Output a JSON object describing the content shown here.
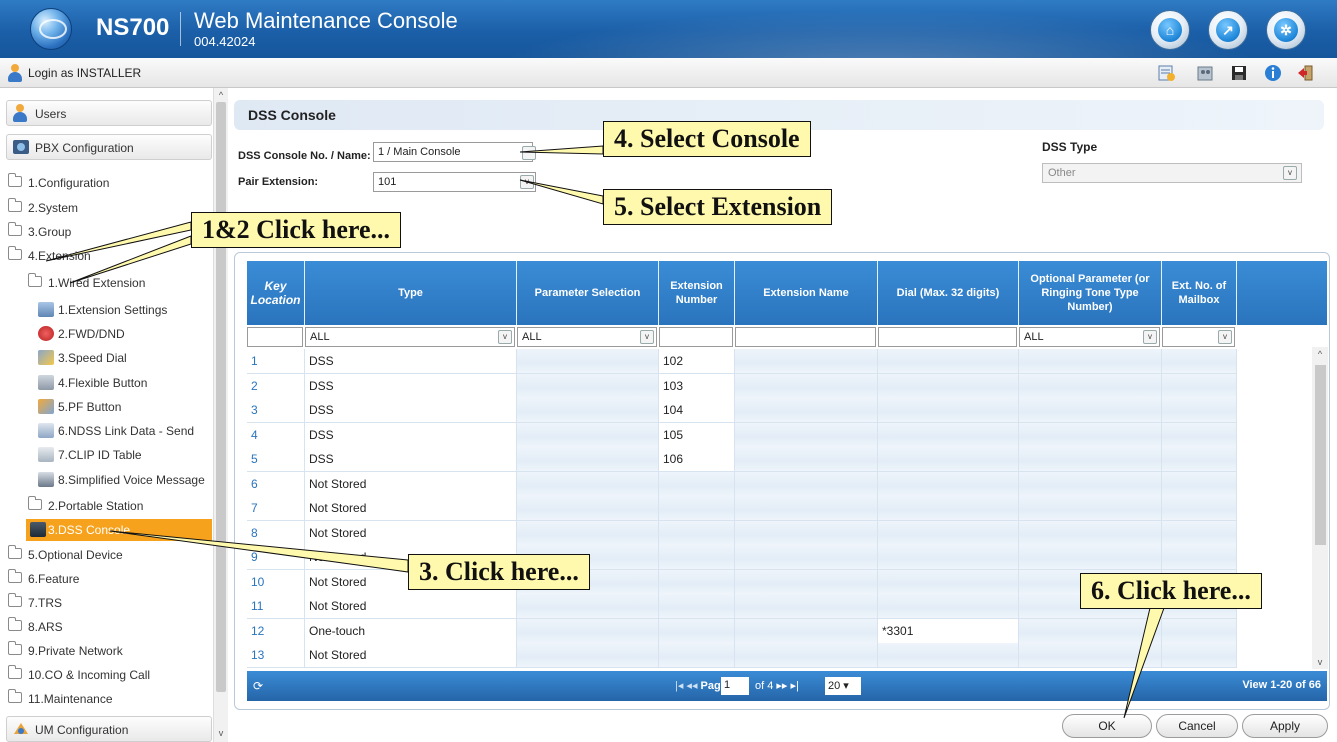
{
  "header": {
    "brand": "NS700",
    "title": "Web Maintenance Console",
    "version": "004.42024",
    "buttons": [
      "home-icon",
      "wrench-icon",
      "gear-icon"
    ]
  },
  "login": {
    "text": "Login as INSTALLER"
  },
  "toolbar": {
    "icons": [
      "help-doc-icon",
      "users-icon",
      "save-icon",
      "info-icon",
      "logout-icon"
    ]
  },
  "sidebar": {
    "sections": [
      {
        "label": "Users"
      },
      {
        "label": "PBX Configuration"
      },
      {
        "label": "UM Configuration"
      }
    ],
    "folders": [
      "1.Configuration",
      "2.System",
      "3.Group",
      "4.Extension",
      "5.Optional Device",
      "6.Feature",
      "7.TRS",
      "8.ARS",
      "9.Private Network",
      "10.CO & Incoming Call",
      "11.Maintenance"
    ],
    "subfolders": [
      "1.Wired Extension",
      "2.Portable Station"
    ],
    "items": [
      "1.Extension Settings",
      "2.FWD/DND",
      "3.Speed Dial",
      "4.Flexible Button",
      "5.PF Button",
      "6.NDSS Link Data - Send",
      "7.CLIP ID Table",
      "8.Simplified Voice Message"
    ],
    "active_item": "3.DSS Console"
  },
  "panel": {
    "title": "DSS Console",
    "console_label": "DSS Console No. / Name:",
    "console_value": "1 / Main Console",
    "pair_label": "Pair Extension:",
    "pair_value": "101",
    "dss_type_label": "DSS Type",
    "dss_type_value": "Other"
  },
  "table": {
    "columns": [
      "Key Location",
      "Type",
      "Parameter Selection",
      "Extension Number",
      "Extension Name",
      "Dial (Max. 32 digits)",
      "Optional Parameter (or Ringing Tone Type Number)",
      "Ext. No. of Mailbox"
    ],
    "filters": {
      "type": "ALL",
      "param": "ALL",
      "optional": "ALL"
    },
    "rows": [
      {
        "key": "1",
        "type": "DSS",
        "ext": "102",
        "dial": ""
      },
      {
        "key": "2",
        "type": "DSS",
        "ext": "103",
        "dial": ""
      },
      {
        "key": "3",
        "type": "DSS",
        "ext": "104",
        "dial": ""
      },
      {
        "key": "4",
        "type": "DSS",
        "ext": "105",
        "dial": ""
      },
      {
        "key": "5",
        "type": "DSS",
        "ext": "106",
        "dial": ""
      },
      {
        "key": "6",
        "type": "Not Stored",
        "ext": "",
        "dial": ""
      },
      {
        "key": "7",
        "type": "Not Stored",
        "ext": "",
        "dial": ""
      },
      {
        "key": "8",
        "type": "Not Stored",
        "ext": "",
        "dial": ""
      },
      {
        "key": "9",
        "type": "Not Stored",
        "ext": "",
        "dial": ""
      },
      {
        "key": "10",
        "type": "Not Stored",
        "ext": "",
        "dial": ""
      },
      {
        "key": "11",
        "type": "Not Stored",
        "ext": "",
        "dial": ""
      },
      {
        "key": "12",
        "type": "One-touch",
        "ext": "",
        "dial": "*3301"
      },
      {
        "key": "13",
        "type": "Not Stored",
        "ext": "",
        "dial": ""
      }
    ],
    "pager": {
      "page_label": "Page",
      "page": "1",
      "of_label": "of 4",
      "page_size": "20",
      "view": "View 1-20 of 66"
    }
  },
  "buttons": {
    "ok": "OK",
    "cancel": "Cancel",
    "apply": "Apply"
  },
  "callouts": {
    "select_console": "4. Select Console",
    "select_extension": "5. Select Extension",
    "click_12": "1&2 Click here...",
    "click_3": "3. Click here...",
    "click_6": "6. Click here..."
  },
  "colors": {
    "accent": "#2a74bd",
    "active": "#f7a21d",
    "callout_bg": "#fff9ad"
  }
}
